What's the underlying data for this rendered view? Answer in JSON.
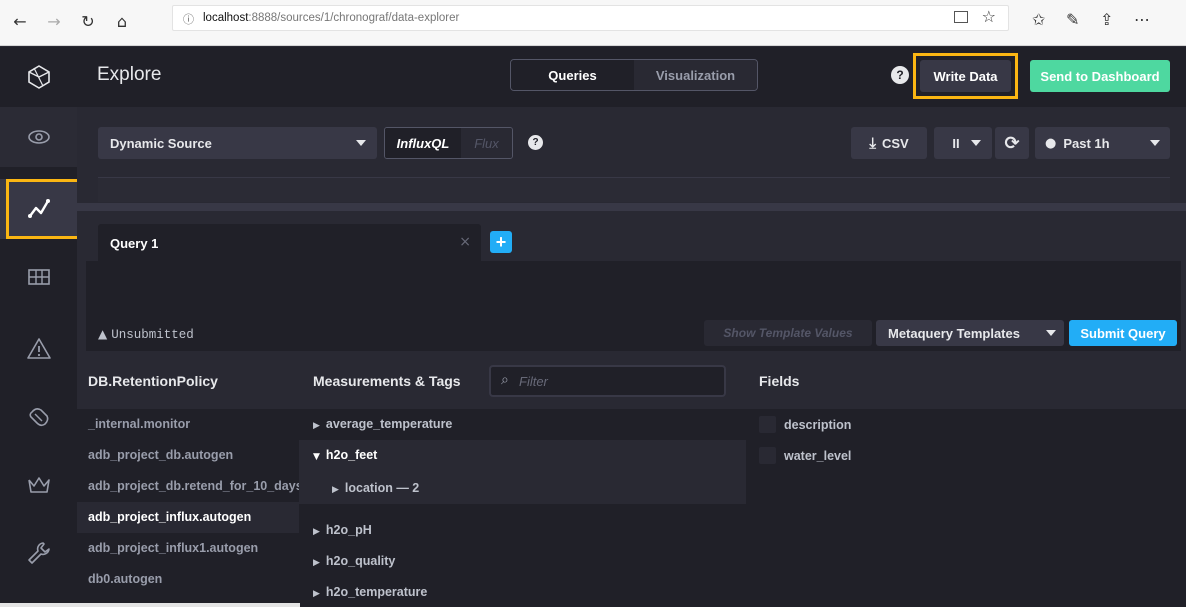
{
  "browser": {
    "url_host": "localhost",
    "url_rest": ":8888/sources/1/chronograf/data-explorer",
    "info_icon": "info-icon"
  },
  "header": {
    "title": "Explore",
    "tabs": [
      {
        "label": "Queries",
        "active": true
      },
      {
        "label": "Visualization",
        "active": false
      }
    ],
    "help": "?",
    "write_data": "Write Data",
    "send_dashboard": "Send to Dashboard"
  },
  "toolbar": {
    "source": "Dynamic Source",
    "lang_influxql": "InfluxQL",
    "lang_flux": "Flux",
    "help": "?",
    "csv": "CSV",
    "pause": "II",
    "time_range": "Past 1h"
  },
  "query_tabs": {
    "tab_label": "Query 1",
    "close": "×",
    "add": "+"
  },
  "editor": {
    "status": "Unsubmitted",
    "show_template_values": "Show Template Values",
    "metaquery_templates": "Metaquery Templates",
    "submit": "Submit Query"
  },
  "schema": {
    "db_header": "DB.RetentionPolicy",
    "measurements_header": "Measurements & Tags",
    "filter_placeholder": "Filter",
    "fields_header": "Fields",
    "databases": [
      "_internal.monitor",
      "adb_project_db.autogen",
      "adb_project_db.retend_for_10_days",
      "adb_project_influx.autogen",
      "adb_project_influx1.autogen",
      "db0.autogen"
    ],
    "selected_database": "adb_project_influx.autogen",
    "measurements": [
      "average_temperature",
      "h2o_feet",
      "h2o_pH",
      "h2o_quality",
      "h2o_temperature"
    ],
    "open_tag": "location — 2",
    "fields": [
      "description",
      "water_level"
    ]
  },
  "colors": {
    "highlight": "#fbb613",
    "primary": "#22adf6",
    "success": "#4ed8a0"
  }
}
